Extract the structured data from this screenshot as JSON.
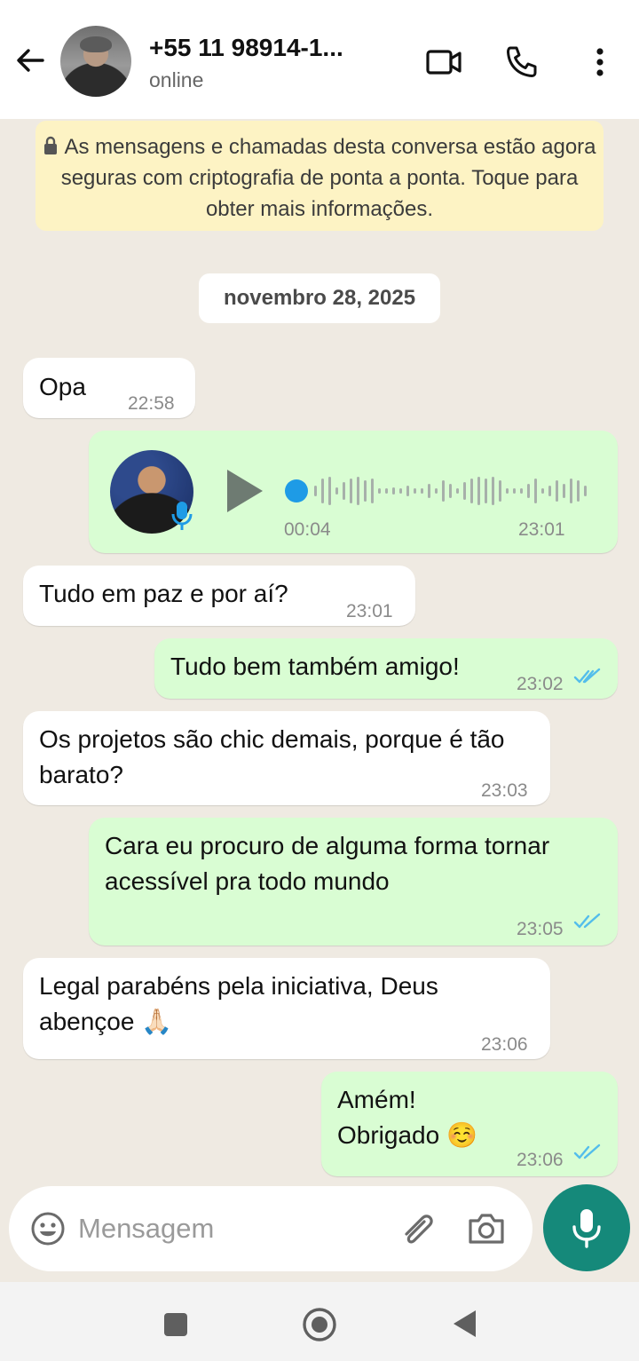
{
  "header": {
    "contact_name": "+55 11 98914-1...",
    "status": "online"
  },
  "notice": {
    "text": "As mensagens e chamadas desta conversa estão agora seguras com criptografia de ponta a ponta. Toque para obter mais informações."
  },
  "date_chip": "novembro 28, 2025",
  "messages": [
    {
      "direction": "in",
      "text": "Opa",
      "time": "22:58"
    },
    {
      "direction": "out",
      "type": "voice",
      "duration": "00:04",
      "time": "23:01"
    },
    {
      "direction": "in",
      "text": "Tudo em paz e por aí?",
      "time": "23:01"
    },
    {
      "direction": "out",
      "text": "Tudo bem também amigo!",
      "time": "23:02"
    },
    {
      "direction": "in",
      "text": "Os projetos são chic demais, porque é tão barato?",
      "time": "23:03"
    },
    {
      "direction": "out",
      "text": "Cara eu procuro de alguma forma tornar acessível pra todo mundo",
      "time": "23:05"
    },
    {
      "direction": "in",
      "text": "Legal parabéns pela iniciativa, Deus abençoe 🙏🏻",
      "time": "23:06"
    },
    {
      "direction": "out",
      "text": "Amém! Obrigado ☺️",
      "time": "23:06"
    }
  ],
  "input": {
    "placeholder": "Mensagem"
  },
  "colors": {
    "chat_background": "#efeae2",
    "outgoing_bubble": "#d9fdd3",
    "incoming_bubble": "#ffffff",
    "notice_background": "#fdf3c4",
    "accent": "#15897a",
    "read_ticks": "#53bdeb",
    "voice_dot": "#1e9be6"
  },
  "icons": {
    "back": "arrow-left-icon",
    "video": "video-camera-icon",
    "call": "phone-icon",
    "menu": "more-vertical-icon",
    "lock": "lock-icon",
    "emoji": "smiley-icon",
    "attach": "paperclip-icon",
    "camera": "camera-icon",
    "mic": "microphone-icon"
  }
}
